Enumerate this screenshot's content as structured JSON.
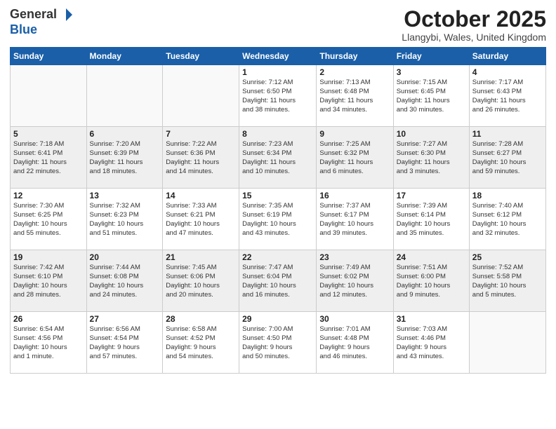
{
  "logo": {
    "general": "General",
    "blue": "Blue"
  },
  "title": "October 2025",
  "location": "Llangybi, Wales, United Kingdom",
  "weekdays": [
    "Sunday",
    "Monday",
    "Tuesday",
    "Wednesday",
    "Thursday",
    "Friday",
    "Saturday"
  ],
  "weeks": [
    [
      {
        "day": "",
        "info": ""
      },
      {
        "day": "",
        "info": ""
      },
      {
        "day": "",
        "info": ""
      },
      {
        "day": "1",
        "info": "Sunrise: 7:12 AM\nSunset: 6:50 PM\nDaylight: 11 hours\nand 38 minutes."
      },
      {
        "day": "2",
        "info": "Sunrise: 7:13 AM\nSunset: 6:48 PM\nDaylight: 11 hours\nand 34 minutes."
      },
      {
        "day": "3",
        "info": "Sunrise: 7:15 AM\nSunset: 6:45 PM\nDaylight: 11 hours\nand 30 minutes."
      },
      {
        "day": "4",
        "info": "Sunrise: 7:17 AM\nSunset: 6:43 PM\nDaylight: 11 hours\nand 26 minutes."
      }
    ],
    [
      {
        "day": "5",
        "info": "Sunrise: 7:18 AM\nSunset: 6:41 PM\nDaylight: 11 hours\nand 22 minutes."
      },
      {
        "day": "6",
        "info": "Sunrise: 7:20 AM\nSunset: 6:39 PM\nDaylight: 11 hours\nand 18 minutes."
      },
      {
        "day": "7",
        "info": "Sunrise: 7:22 AM\nSunset: 6:36 PM\nDaylight: 11 hours\nand 14 minutes."
      },
      {
        "day": "8",
        "info": "Sunrise: 7:23 AM\nSunset: 6:34 PM\nDaylight: 11 hours\nand 10 minutes."
      },
      {
        "day": "9",
        "info": "Sunrise: 7:25 AM\nSunset: 6:32 PM\nDaylight: 11 hours\nand 6 minutes."
      },
      {
        "day": "10",
        "info": "Sunrise: 7:27 AM\nSunset: 6:30 PM\nDaylight: 11 hours\nand 3 minutes."
      },
      {
        "day": "11",
        "info": "Sunrise: 7:28 AM\nSunset: 6:27 PM\nDaylight: 10 hours\nand 59 minutes."
      }
    ],
    [
      {
        "day": "12",
        "info": "Sunrise: 7:30 AM\nSunset: 6:25 PM\nDaylight: 10 hours\nand 55 minutes."
      },
      {
        "day": "13",
        "info": "Sunrise: 7:32 AM\nSunset: 6:23 PM\nDaylight: 10 hours\nand 51 minutes."
      },
      {
        "day": "14",
        "info": "Sunrise: 7:33 AM\nSunset: 6:21 PM\nDaylight: 10 hours\nand 47 minutes."
      },
      {
        "day": "15",
        "info": "Sunrise: 7:35 AM\nSunset: 6:19 PM\nDaylight: 10 hours\nand 43 minutes."
      },
      {
        "day": "16",
        "info": "Sunrise: 7:37 AM\nSunset: 6:17 PM\nDaylight: 10 hours\nand 39 minutes."
      },
      {
        "day": "17",
        "info": "Sunrise: 7:39 AM\nSunset: 6:14 PM\nDaylight: 10 hours\nand 35 minutes."
      },
      {
        "day": "18",
        "info": "Sunrise: 7:40 AM\nSunset: 6:12 PM\nDaylight: 10 hours\nand 32 minutes."
      }
    ],
    [
      {
        "day": "19",
        "info": "Sunrise: 7:42 AM\nSunset: 6:10 PM\nDaylight: 10 hours\nand 28 minutes."
      },
      {
        "day": "20",
        "info": "Sunrise: 7:44 AM\nSunset: 6:08 PM\nDaylight: 10 hours\nand 24 minutes."
      },
      {
        "day": "21",
        "info": "Sunrise: 7:45 AM\nSunset: 6:06 PM\nDaylight: 10 hours\nand 20 minutes."
      },
      {
        "day": "22",
        "info": "Sunrise: 7:47 AM\nSunset: 6:04 PM\nDaylight: 10 hours\nand 16 minutes."
      },
      {
        "day": "23",
        "info": "Sunrise: 7:49 AM\nSunset: 6:02 PM\nDaylight: 10 hours\nand 12 minutes."
      },
      {
        "day": "24",
        "info": "Sunrise: 7:51 AM\nSunset: 6:00 PM\nDaylight: 10 hours\nand 9 minutes."
      },
      {
        "day": "25",
        "info": "Sunrise: 7:52 AM\nSunset: 5:58 PM\nDaylight: 10 hours\nand 5 minutes."
      }
    ],
    [
      {
        "day": "26",
        "info": "Sunrise: 6:54 AM\nSunset: 4:56 PM\nDaylight: 10 hours\nand 1 minute."
      },
      {
        "day": "27",
        "info": "Sunrise: 6:56 AM\nSunset: 4:54 PM\nDaylight: 9 hours\nand 57 minutes."
      },
      {
        "day": "28",
        "info": "Sunrise: 6:58 AM\nSunset: 4:52 PM\nDaylight: 9 hours\nand 54 minutes."
      },
      {
        "day": "29",
        "info": "Sunrise: 7:00 AM\nSunset: 4:50 PM\nDaylight: 9 hours\nand 50 minutes."
      },
      {
        "day": "30",
        "info": "Sunrise: 7:01 AM\nSunset: 4:48 PM\nDaylight: 9 hours\nand 46 minutes."
      },
      {
        "day": "31",
        "info": "Sunrise: 7:03 AM\nSunset: 4:46 PM\nDaylight: 9 hours\nand 43 minutes."
      },
      {
        "day": "",
        "info": ""
      }
    ]
  ]
}
